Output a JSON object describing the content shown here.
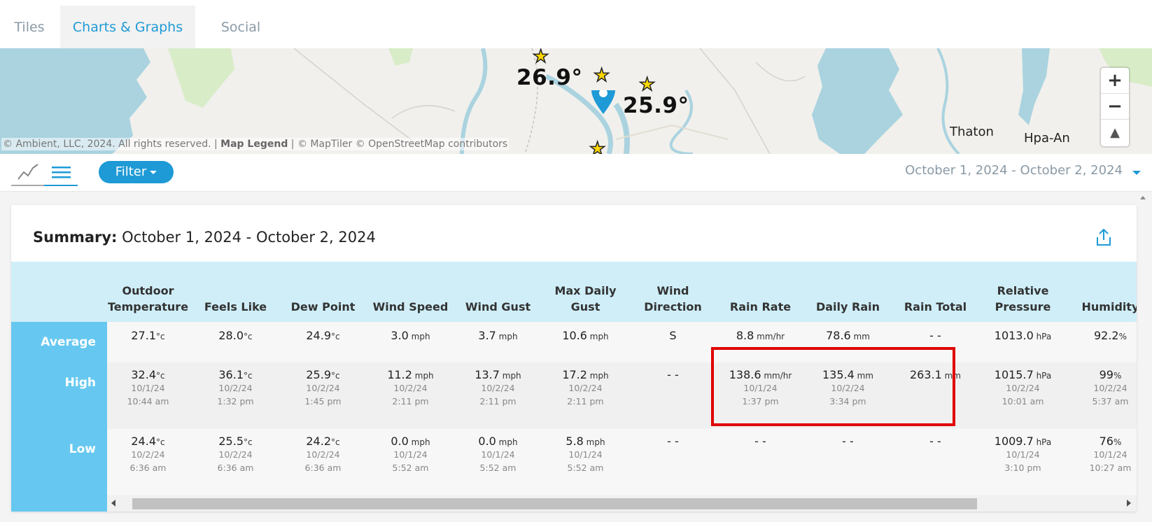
{
  "tabs": [
    {
      "label": "Tiles"
    },
    {
      "label": "Charts & Graphs"
    },
    {
      "label": "Social"
    }
  ],
  "map": {
    "temps": [
      "26.9°",
      "25.9°"
    ],
    "cities": [
      "Thaton",
      "Hpa-An"
    ],
    "attribution": {
      "prefix": "© Ambient, LLC, 2024. All rights reserved. | ",
      "legend_link": "Map Legend",
      "suffix": " | © MapTiler © OpenStreetMap contributors"
    },
    "zoom_in": "+",
    "zoom_out": "−",
    "compass": "▲"
  },
  "toolbar": {
    "filter_label": "Filter",
    "date_range": "October 1, 2024 - October 2, 2024"
  },
  "summary": {
    "title_bold": "Summary:",
    "title_range": "October 1, 2024 - October 2, 2024"
  },
  "table": {
    "columns": [
      [
        "Outdoor",
        "Temperature"
      ],
      [
        "",
        "Feels Like"
      ],
      [
        "",
        "Dew Point"
      ],
      [
        "",
        "Wind Speed"
      ],
      [
        "",
        "Wind Gust"
      ],
      [
        "Max Daily",
        "Gust"
      ],
      [
        "Wind",
        "Direction"
      ],
      [
        "",
        "Rain Rate"
      ],
      [
        "",
        "Daily Rain"
      ],
      [
        "",
        "Rain Total"
      ],
      [
        "Relative",
        "Pressure"
      ],
      [
        "",
        "Humidity"
      ]
    ],
    "row_labels": [
      "Average",
      "High",
      "Low"
    ],
    "average": [
      {
        "v": "27.1",
        "u": "°c"
      },
      {
        "v": "28.0",
        "u": "°c"
      },
      {
        "v": "24.9",
        "u": "°c"
      },
      {
        "v": "3.0",
        "u": " mph"
      },
      {
        "v": "3.7",
        "u": " mph"
      },
      {
        "v": "10.6",
        "u": " mph"
      },
      {
        "v": "S",
        "u": ""
      },
      {
        "v": "8.8",
        "u": " mm/hr"
      },
      {
        "v": "78.6",
        "u": " mm"
      },
      {
        "v": "- -",
        "u": ""
      },
      {
        "v": "1013.0",
        "u": " hPa"
      },
      {
        "v": "92.2",
        "u": "%"
      }
    ],
    "high": [
      {
        "v": "32.4",
        "u": "°c",
        "date": "10/1/24",
        "time": "10:44 am"
      },
      {
        "v": "36.1",
        "u": "°c",
        "date": "10/2/24",
        "time": "1:32 pm"
      },
      {
        "v": "25.9",
        "u": "°c",
        "date": "10/2/24",
        "time": "1:45 pm"
      },
      {
        "v": "11.2",
        "u": " mph",
        "date": "10/2/24",
        "time": "2:11 pm"
      },
      {
        "v": "13.7",
        "u": " mph",
        "date": "10/2/24",
        "time": "2:11 pm"
      },
      {
        "v": "17.2",
        "u": " mph",
        "date": "10/2/24",
        "time": "2:11 pm"
      },
      {
        "v": "- -",
        "u": "",
        "date": "",
        "time": ""
      },
      {
        "v": "138.6",
        "u": " mm/hr",
        "date": "10/1/24",
        "time": "1:37 pm"
      },
      {
        "v": "135.4",
        "u": " mm",
        "date": "10/2/24",
        "time": "3:34 pm"
      },
      {
        "v": "263.1",
        "u": " mm",
        "date": "",
        "time": ""
      },
      {
        "v": "1015.7",
        "u": " hPa",
        "date": "10/2/24",
        "time": "10:01 am"
      },
      {
        "v": "99",
        "u": "%",
        "date": "10/2/24",
        "time": "5:37 am"
      }
    ],
    "low": [
      {
        "v": "24.4",
        "u": "°c",
        "date": "10/2/24",
        "time": "6:36 am"
      },
      {
        "v": "25.5",
        "u": "°c",
        "date": "10/2/24",
        "time": "6:36 am"
      },
      {
        "v": "24.2",
        "u": "°c",
        "date": "10/2/24",
        "time": "6:36 am"
      },
      {
        "v": "0.0",
        "u": " mph",
        "date": "10/1/24",
        "time": "5:52 am"
      },
      {
        "v": "0.0",
        "u": " mph",
        "date": "10/1/24",
        "time": "5:52 am"
      },
      {
        "v": "5.8",
        "u": " mph",
        "date": "10/1/24",
        "time": "5:52 am"
      },
      {
        "v": "- -",
        "u": "",
        "date": "",
        "time": ""
      },
      {
        "v": "- -",
        "u": "",
        "date": "",
        "time": ""
      },
      {
        "v": "- -",
        "u": "",
        "date": "",
        "time": ""
      },
      {
        "v": "- -",
        "u": "",
        "date": "",
        "time": ""
      },
      {
        "v": "1009.7",
        "u": " hPa",
        "date": "10/1/24",
        "time": "3:10 pm"
      },
      {
        "v": "76",
        "u": "%",
        "date": "10/1/24",
        "time": "10:27 am"
      }
    ]
  }
}
